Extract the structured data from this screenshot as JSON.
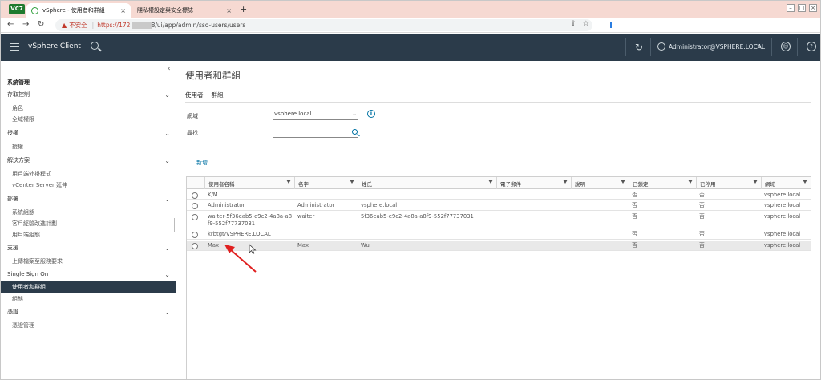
{
  "browser": {
    "badge": "VC7",
    "tabs": [
      {
        "label": "vSphere - 使用者和群組",
        "close": "×"
      },
      {
        "label": "隱私權設定與安全標誌",
        "close": "×"
      }
    ],
    "new_tab": "+",
    "window_controls": [
      "–",
      "□",
      "×"
    ],
    "address": {
      "insecure_label": "不安全",
      "url_scheme": "https://172.",
      "url_redacted": "          ",
      "url_rest": "8/ui/app/admin/sso-users/users"
    }
  },
  "header": {
    "app_title": "vSphere Client",
    "user": "Administrator@VSPHERE.LOCAL",
    "help": "?",
    "smile": "☺"
  },
  "sidebar": {
    "root": "系統管理",
    "sections": [
      {
        "label": "存取控制",
        "items": [
          "角色",
          "全域權限"
        ]
      },
      {
        "label": "授權",
        "items": [
          "授權"
        ]
      },
      {
        "label": "解決方案",
        "items": [
          "用戶端外掛程式",
          "vCenter Server 延伸"
        ]
      },
      {
        "label": "部署",
        "items": [
          "系統組態",
          "客戶經驗改進計劃",
          "用戶端組態"
        ]
      },
      {
        "label": "支援",
        "items": [
          "上傳檔案至服務要求"
        ]
      },
      {
        "label": "Single Sign On",
        "items": [
          "使用者和群組",
          "組態"
        ]
      },
      {
        "label": "憑證",
        "items": [
          "憑證管理"
        ]
      }
    ],
    "selected": "使用者和群組"
  },
  "main": {
    "title": "使用者和群組",
    "tabs": [
      "使用者",
      "群組"
    ],
    "domain_label": "網域",
    "domain_value": "vsphere.local",
    "find_label": "尋找",
    "add_label": "新增",
    "columns": [
      "使用者名稱",
      "名字",
      "姓氏",
      "電子郵件",
      "說明",
      "已鎖定",
      "已停用",
      "網域"
    ],
    "rows": [
      [
        "K/M",
        "",
        "",
        "",
        "",
        "否",
        "否",
        "vsphere.local"
      ],
      [
        "Administrator",
        "Administrator",
        "vsphere.local",
        "",
        "",
        "否",
        "否",
        "vsphere.local"
      ],
      [
        "waiter-5f36eab5-e9c2-4a8a-a8f9-552f77737031",
        "waiter",
        "5f36eab5-e9c2-4a8a-a8f9-552f77737031",
        "",
        "",
        "否",
        "否",
        "vsphere.local"
      ],
      [
        "krbtgt/VSPHERE.LOCAL",
        "",
        "",
        "",
        "",
        "否",
        "否",
        "vsphere.local"
      ],
      [
        "Max",
        "Max",
        "Wu",
        "",
        "",
        "否",
        "否",
        "vsphere.local"
      ]
    ],
    "highlighted_row": 4
  },
  "colors": {
    "header_bg": "#2b3b4a",
    "accent": "#0072a3",
    "tabstrip_bg": "#f6d9d2",
    "annotation_arrow": "#e02020"
  }
}
